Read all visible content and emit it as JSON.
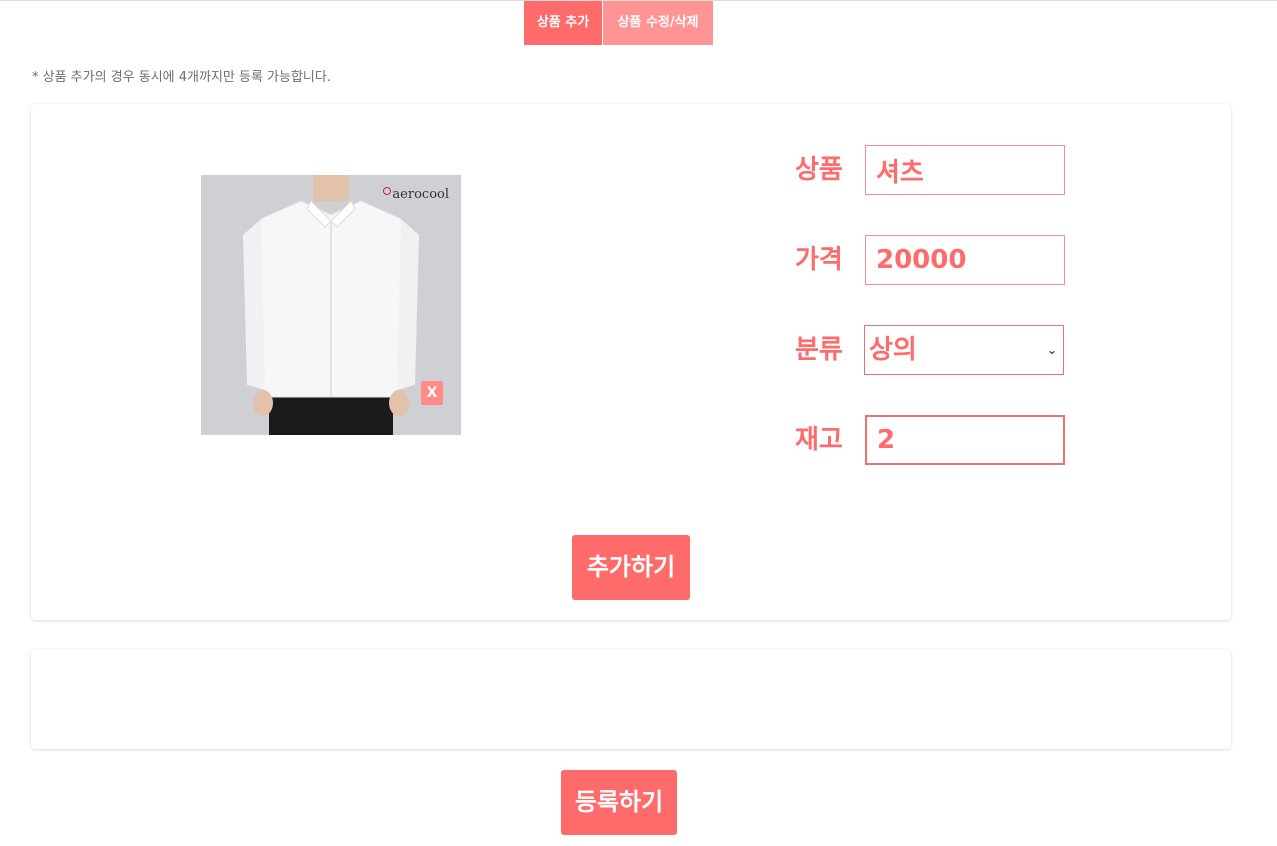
{
  "tabs": {
    "add_label": "상품 추가",
    "edit_label": "상품 수정/삭제"
  },
  "notice": "* 상품 추가의 경우 동시에 4개까지만 등록 가능합니다.",
  "product": {
    "image": {
      "brand": "aerocool",
      "remove_label": "X"
    },
    "fields": {
      "name_label": "상품",
      "name_value": "셔츠",
      "price_label": "가격",
      "price_value": "20000",
      "category_label": "분류",
      "category_value": "상의",
      "stock_label": "재고",
      "stock_value": "2"
    },
    "add_button": "추가하기"
  },
  "register_button": "등록하기",
  "colors": {
    "accent": "#ff6a6a",
    "accent_light": "#ff9494"
  },
  "icons": {
    "select_arrow": "chevron-down-icon"
  }
}
